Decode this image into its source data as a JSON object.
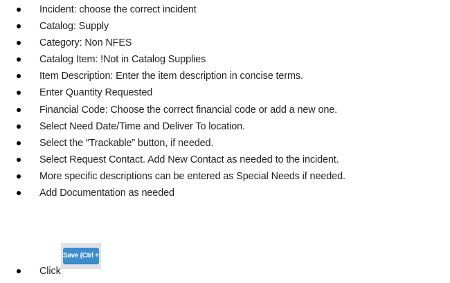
{
  "instructions": {
    "items": [
      "Incident: choose the correct incident",
      "Catalog: Supply",
      "Category: Non NFES",
      "Catalog Item: !Not in Catalog Supplies",
      "Item Description: Enter the item description in concise terms.",
      "Enter Quantity Requested",
      "Financial Code: Choose the correct financial code or add a new one.",
      "Select Need Date/Time and Deliver To location.",
      "Select the “Trackable” button, if needed.",
      "Select Request Contact. Add New Contact as needed to the incident.",
      "More specific descriptions can be entered as Special Needs if needed.",
      "Add Documentation as needed",
      "Click"
    ],
    "save_button_label": "Save (Ctrl + s)"
  },
  "colors": {
    "save_button": "#3c8dcc",
    "save_button_frame": "#dfe3e8"
  }
}
